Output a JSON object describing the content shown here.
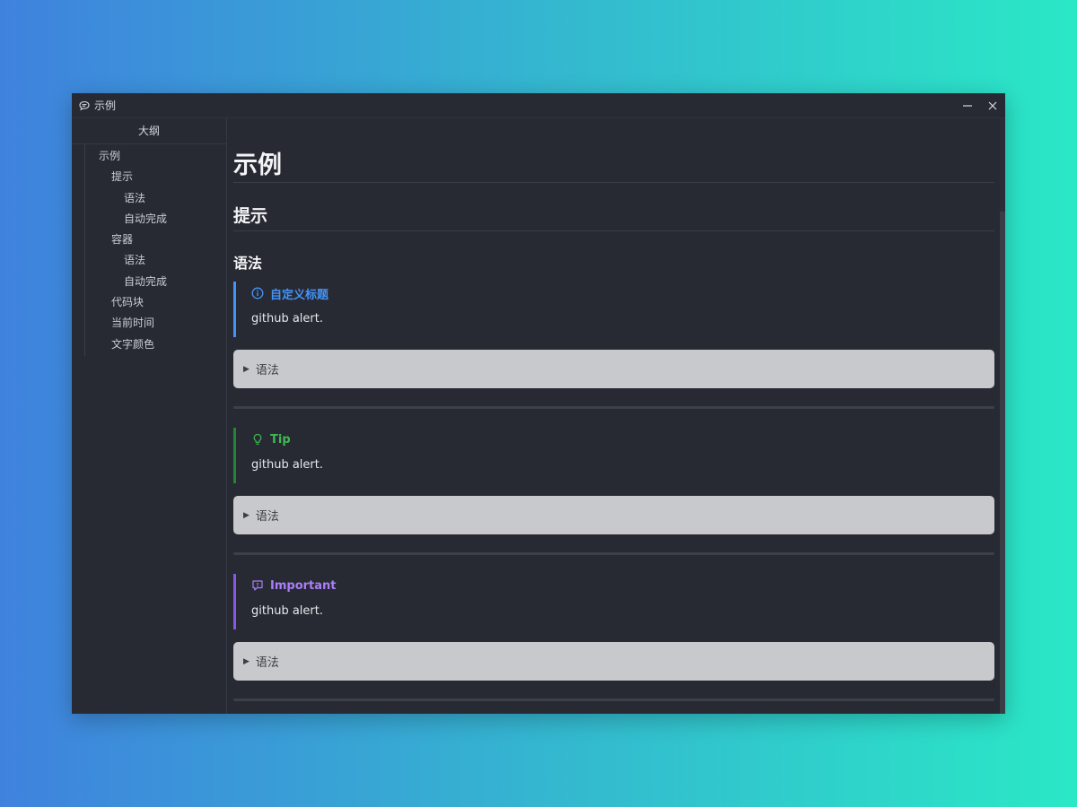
{
  "window": {
    "title": "示例",
    "app_icon": "chat-bubble-icon",
    "minimize_icon": "minus-icon",
    "close_icon": "close-icon"
  },
  "sidebar": {
    "header": "大纲",
    "items": [
      {
        "label": "示例",
        "level": 1
      },
      {
        "label": "提示",
        "level": 2
      },
      {
        "label": "语法",
        "level": 3
      },
      {
        "label": "自动完成",
        "level": 3
      },
      {
        "label": "容器",
        "level": 2
      },
      {
        "label": "语法",
        "level": 3
      },
      {
        "label": "自动完成",
        "level": 3
      },
      {
        "label": "代码块",
        "level": 2
      },
      {
        "label": "当前时间",
        "level": 2
      },
      {
        "label": "文字颜色",
        "level": 2
      }
    ]
  },
  "content": {
    "h1": "示例",
    "h2": "提示",
    "h3": "语法",
    "alerts": [
      {
        "title": "自定义标题",
        "body": "github alert.",
        "icon": "info-icon",
        "color": "#4493f8",
        "details": "语法"
      },
      {
        "title": "Tip",
        "body": "github alert.",
        "icon": "lightbulb-icon",
        "color": "#3fb950",
        "details": "语法"
      },
      {
        "title": "Important",
        "body": "github alert.",
        "icon": "report-icon",
        "color": "#ab7df8",
        "details": "语法"
      }
    ]
  },
  "colors": {
    "background_gradient_start": "#3f82de",
    "background_gradient_end": "#2ae8c6",
    "window_bg": "#272a33",
    "details_bg": "#c8c9cd"
  }
}
